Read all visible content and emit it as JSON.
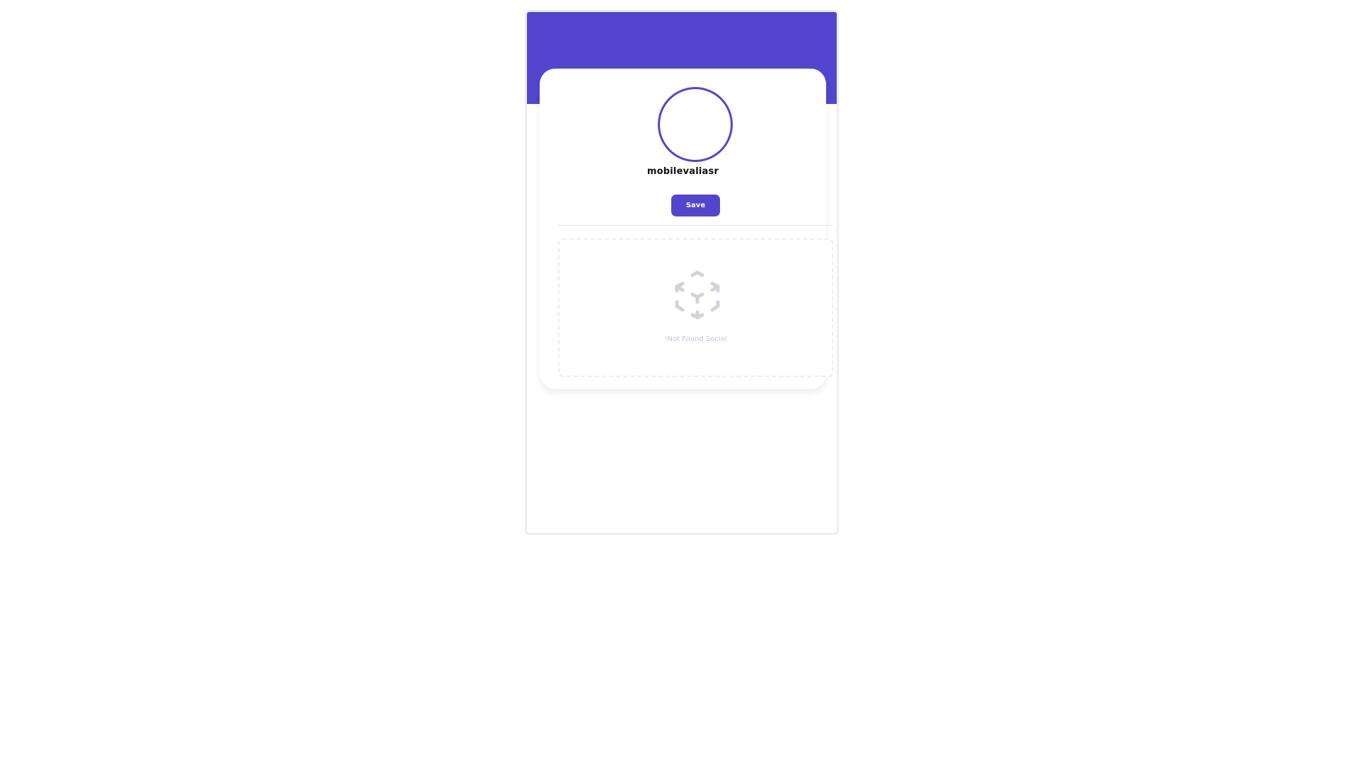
{
  "profile": {
    "username": "mobilevaliasr",
    "save_label": "Save"
  },
  "social": {
    "empty_icon": "dashed-cube-icon",
    "empty_text": "!Not Found Social"
  },
  "colors": {
    "accent": "#5146cd",
    "muted": "#c4c4d2",
    "border": "#ececf1"
  }
}
